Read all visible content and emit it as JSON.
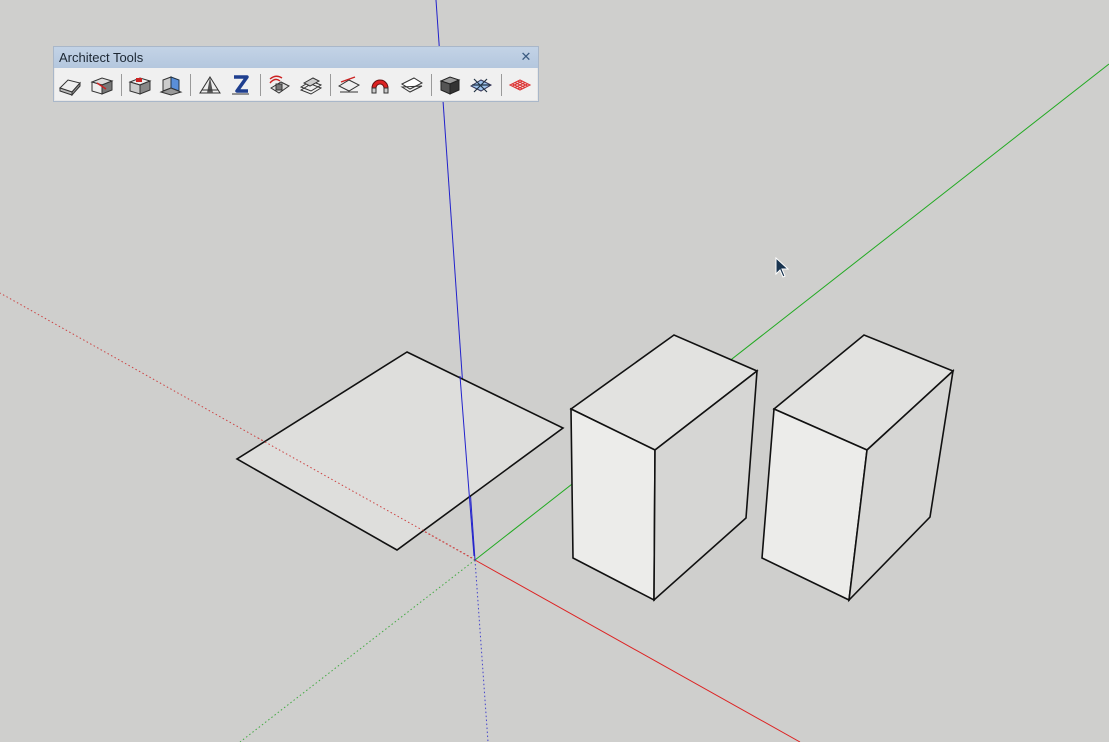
{
  "toolbar": {
    "title": "Architect Tools",
    "close_glyph": "✕",
    "groups": [
      [
        {
          "name": "building-maker-icon"
        },
        {
          "name": "roof-maker-icon"
        }
      ],
      [
        {
          "name": "stair-maker-icon"
        },
        {
          "name": "wall-extrude-icon"
        }
      ],
      [
        {
          "name": "gable-tool-icon"
        },
        {
          "name": "elevation-z-icon"
        }
      ],
      [
        {
          "name": "contour-tool-icon"
        },
        {
          "name": "layer-stack-icon"
        }
      ],
      [
        {
          "name": "section-plane-icon"
        },
        {
          "name": "magnet-snap-icon"
        },
        {
          "name": "flat-shape-icon"
        }
      ],
      [
        {
          "name": "box-model-icon"
        },
        {
          "name": "grid-intersect-icon"
        }
      ],
      [
        {
          "name": "red-grid-icon"
        }
      ]
    ]
  },
  "scene": {
    "objects": [
      "flat-rectangle",
      "box-left",
      "box-right"
    ],
    "axes": [
      "red-axis",
      "green-axis",
      "blue-axis"
    ]
  }
}
